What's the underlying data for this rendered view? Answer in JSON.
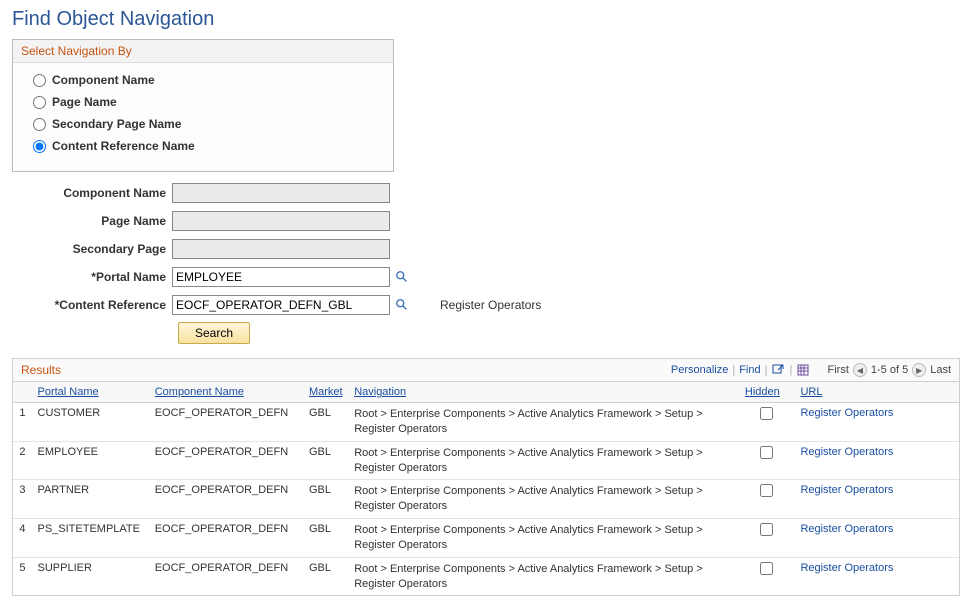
{
  "page_title": "Find Object Navigation",
  "group_box": {
    "title": "Select Navigation By",
    "options": [
      {
        "label": "Component Name",
        "checked": false
      },
      {
        "label": "Page Name",
        "checked": false
      },
      {
        "label": "Secondary Page Name",
        "checked": false
      },
      {
        "label": "Content Reference Name",
        "checked": true
      }
    ]
  },
  "form": {
    "component_name": {
      "label": "Component Name",
      "value": ""
    },
    "page_name": {
      "label": "Page Name",
      "value": ""
    },
    "secondary_page": {
      "label": "Secondary Page",
      "value": ""
    },
    "portal_name": {
      "label": "*Portal Name",
      "value": "EMPLOYEE"
    },
    "content_reference": {
      "label": "*Content Reference",
      "value": "EOCF_OPERATOR_DEFN_GBL",
      "side_text": "Register Operators"
    },
    "search_label": "Search"
  },
  "results": {
    "title": "Results",
    "toolbar": {
      "personalize": "Personalize",
      "find": "Find",
      "first": "First",
      "range": "1-5 of 5",
      "last": "Last"
    },
    "columns": {
      "portal": "Portal Name",
      "component": "Component Name",
      "market": "Market",
      "navigation": "Navigation",
      "hidden": "Hidden",
      "url": "URL"
    },
    "rows": [
      {
        "n": "1",
        "portal": "CUSTOMER",
        "component": "EOCF_OPERATOR_DEFN",
        "market": "GBL",
        "navigation": "Root > Enterprise Components > Active Analytics Framework > Setup > Register Operators",
        "hidden": false,
        "url_label": "Register Operators"
      },
      {
        "n": "2",
        "portal": "EMPLOYEE",
        "component": "EOCF_OPERATOR_DEFN",
        "market": "GBL",
        "navigation": "Root > Enterprise Components > Active Analytics Framework > Setup > Register Operators",
        "hidden": false,
        "url_label": "Register Operators"
      },
      {
        "n": "3",
        "portal": "PARTNER",
        "component": "EOCF_OPERATOR_DEFN",
        "market": "GBL",
        "navigation": "Root > Enterprise Components > Active Analytics Framework > Setup > Register Operators",
        "hidden": false,
        "url_label": "Register Operators"
      },
      {
        "n": "4",
        "portal": "PS_SITETEMPLATE",
        "component": "EOCF_OPERATOR_DEFN",
        "market": "GBL",
        "navigation": "Root > Enterprise Components > Active Analytics Framework > Setup > Register Operators",
        "hidden": false,
        "url_label": "Register Operators"
      },
      {
        "n": "5",
        "portal": "SUPPLIER",
        "component": "EOCF_OPERATOR_DEFN",
        "market": "GBL",
        "navigation": "Root > Enterprise Components > Active Analytics Framework > Setup > Register Operators",
        "hidden": false,
        "url_label": "Register Operators"
      }
    ]
  }
}
